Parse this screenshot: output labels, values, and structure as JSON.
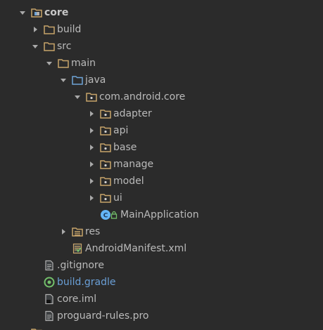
{
  "tree": [
    {
      "label": "core",
      "type": "module",
      "expanded": true,
      "bold": true
    },
    {
      "label": "build",
      "type": "folder",
      "expanded": false
    },
    {
      "label": "src",
      "type": "folder",
      "expanded": true
    },
    {
      "label": "main",
      "type": "folder",
      "expanded": true
    },
    {
      "label": "java",
      "type": "source-folder",
      "expanded": true
    },
    {
      "label": "com.android.core",
      "type": "package",
      "expanded": true
    },
    {
      "label": "adapter",
      "type": "package",
      "expanded": false
    },
    {
      "label": "api",
      "type": "package",
      "expanded": false
    },
    {
      "label": "base",
      "type": "package",
      "expanded": false
    },
    {
      "label": "manage",
      "type": "package",
      "expanded": false
    },
    {
      "label": "model",
      "type": "package",
      "expanded": false
    },
    {
      "label": "ui",
      "type": "package",
      "expanded": false
    },
    {
      "label": "MainApplication",
      "type": "java-class"
    },
    {
      "label": "res",
      "type": "resource-folder",
      "expanded": false
    },
    {
      "label": "AndroidManifest.xml",
      "type": "manifest-file"
    },
    {
      "label": ".gitignore",
      "type": "text-file"
    },
    {
      "label": "build.gradle",
      "type": "gradle-file"
    },
    {
      "label": "core.iml",
      "type": "iml-file"
    },
    {
      "label": "proguard-rules.pro",
      "type": "text-file"
    }
  ],
  "colors": {
    "background": "#2b2b2b",
    "text": "#bababa",
    "gradle_text": "#6a9fd6",
    "folder": "#c8a46a",
    "class_icon": "#64b5f6"
  }
}
